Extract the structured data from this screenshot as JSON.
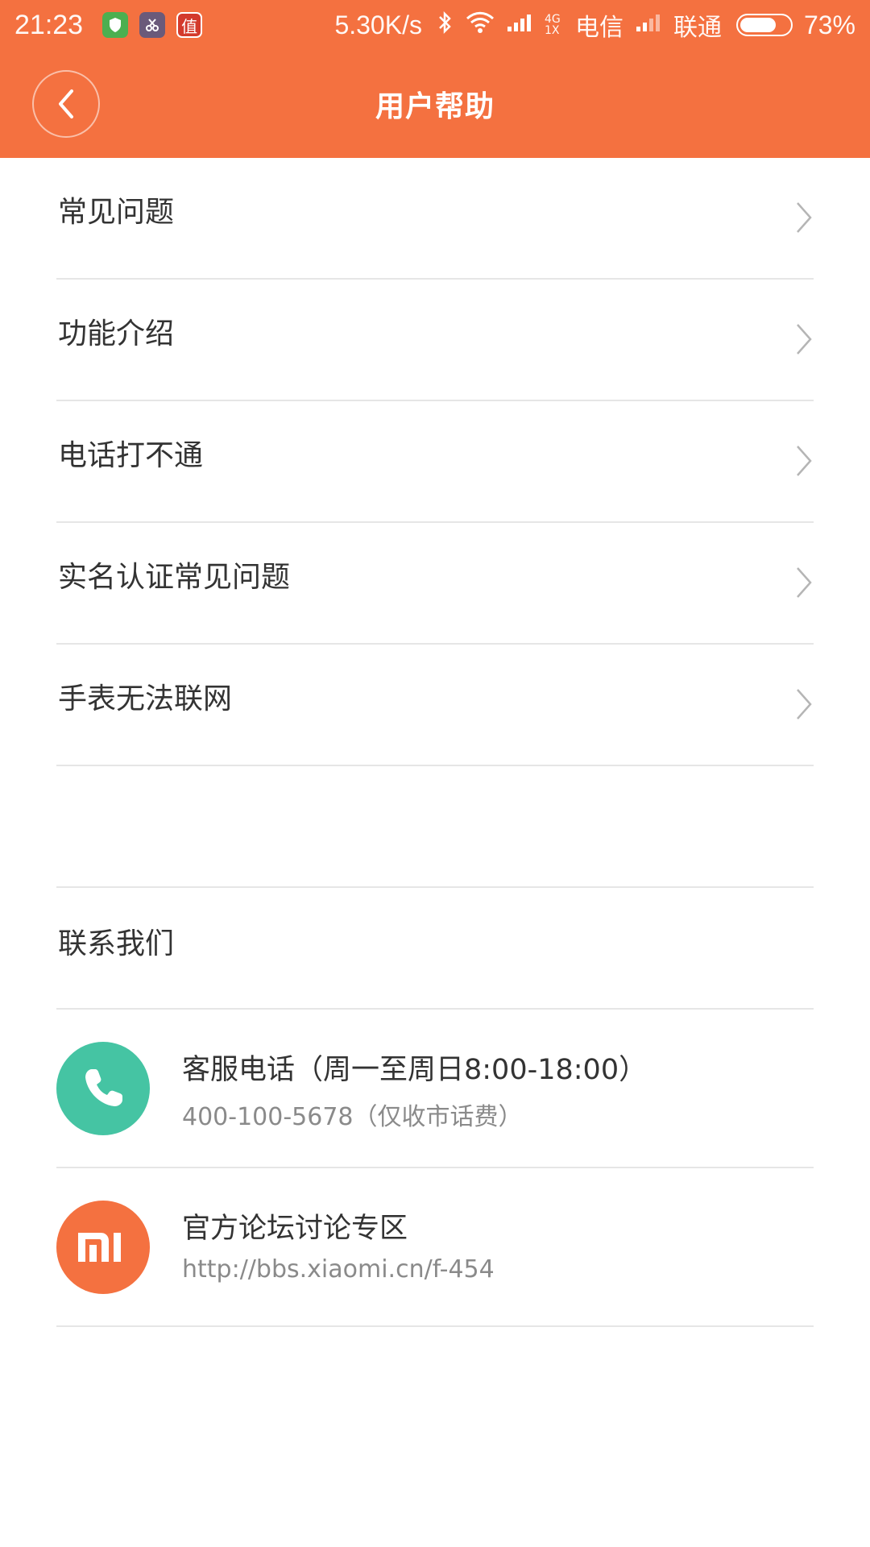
{
  "status_bar": {
    "time": "21:23",
    "app_icons": [
      "shield-app-icon",
      "scissors-app-icon",
      "zhi-app-icon"
    ],
    "app_icon_3_char": "值",
    "network_speed": "5.30K/s",
    "network_type": "4G 1X",
    "carrier_1": "电信",
    "carrier_2": "联通",
    "battery_percent": "73%",
    "battery_level": 0.73
  },
  "header": {
    "title": "用户帮助",
    "back_icon": "chevron-left-icon",
    "bg_color": "#f47140"
  },
  "menu": {
    "items": [
      {
        "label": "常见问题"
      },
      {
        "label": "功能介绍"
      },
      {
        "label": "电话打不通"
      },
      {
        "label": "实名认证常见问题"
      },
      {
        "label": "手表无法联网"
      }
    ]
  },
  "contact": {
    "section_title": "联系我们",
    "items": [
      {
        "icon": "phone-icon",
        "icon_color": "#45c4a3",
        "title": "客服电话（周一至周日8:00-18:00）",
        "subtitle": "400-100-5678（仅收市话费）"
      },
      {
        "icon": "mi-logo-icon",
        "icon_color": "#f47140",
        "title": "官方论坛讨论专区",
        "subtitle": "http://bbs.xiaomi.cn/f-454"
      }
    ]
  }
}
